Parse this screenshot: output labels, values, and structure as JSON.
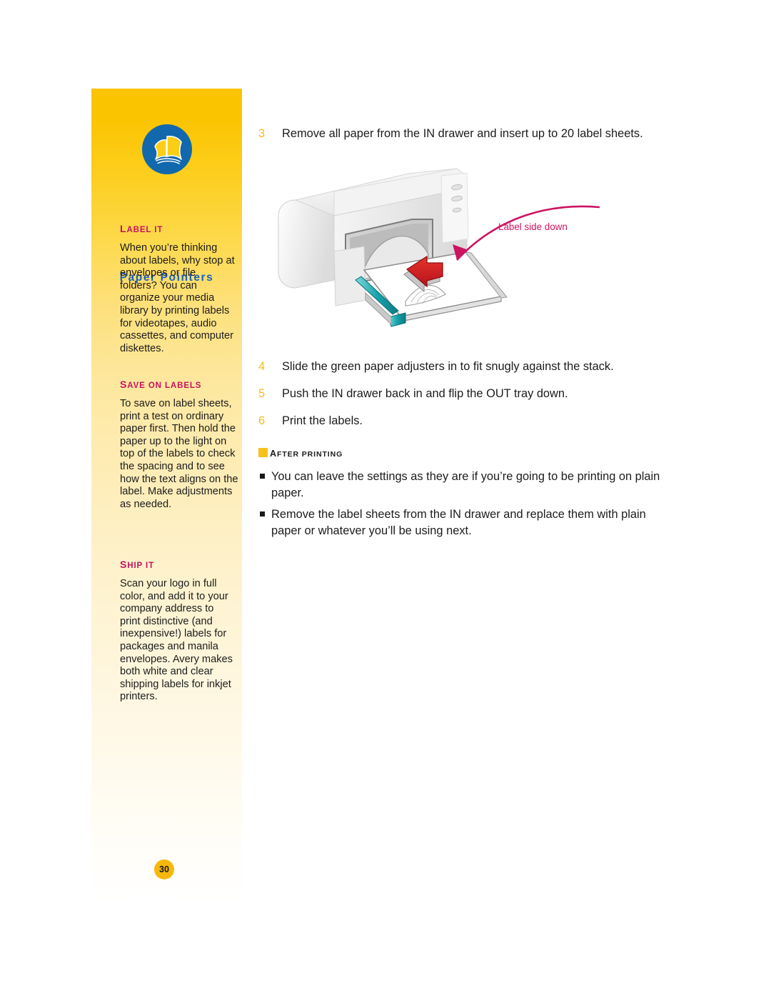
{
  "sidebar": {
    "logo_icon": "fanned-pages-icon",
    "title": "Paper Pointers",
    "page_number": "30",
    "sections": [
      {
        "heading_cap": "L",
        "heading_rest": "ABEL IT",
        "heading_full": "LABEL IT",
        "body": "When you’re thinking about labels, why stop at envelopes or file folders? You can organize your media library by printing labels for videotapes, audio cassettes, and computer diskettes."
      },
      {
        "heading_cap": "S",
        "heading_rest": "AVE ON LABELS",
        "heading_full": "SAVE ON LABELS",
        "body": "To save on label sheets, print a test on ordinary paper first. Then hold the paper up to the light on top of the labels to check the spacing and to see how the text aligns on the label. Make adjustments as needed."
      },
      {
        "heading_cap": "S",
        "heading_rest": "HIP IT",
        "heading_full": "SHIP IT",
        "body": "Scan your logo in full color, and add it to your company address to print distinctive (and inexpensive!) labels for packages and manila envelopes. Avery makes both white and clear shipping labels for inkjet printers."
      }
    ]
  },
  "main": {
    "steps": [
      {
        "number": "3",
        "text": "Remove all paper from the IN drawer and insert up to 20 label sheets."
      },
      {
        "number": "4",
        "text": "Slide the green paper adjusters in to fit snugly against the stack."
      },
      {
        "number": "5",
        "text": "Push the IN drawer back in and flip the OUT tray down."
      },
      {
        "number": "6",
        "text": "Print the labels."
      }
    ],
    "illustration": {
      "name": "inkjet-printer-loading-labels-illustration",
      "callout": "Label side down",
      "callout_color": "#cc1462",
      "arrow_color": "#d2232a",
      "adjuster_color": "#16a0a8",
      "printer_body_color": "#efefef"
    },
    "after_printing": {
      "heading_cap": "A",
      "heading_rest": "FTER PRINTING",
      "heading_full": "AFTER PRINTING",
      "swatch_color": "#f6c21a",
      "bullets": [
        "You can leave the settings as they are if you’re going to be printing on plain paper.",
        "Remove the label sheets from the IN drawer and replace them with plain paper or whatever you’ll be using next."
      ]
    }
  },
  "colors": {
    "sidebar_top": "#fbc400",
    "sidebar_bottom": "#ffffff",
    "title_blue": "#1a5fc0",
    "logo_blue": "#1268ad",
    "heading_crimson": "#c8115c",
    "step_number_gold": "#f5b921",
    "page_badge": "#f7b80e"
  }
}
